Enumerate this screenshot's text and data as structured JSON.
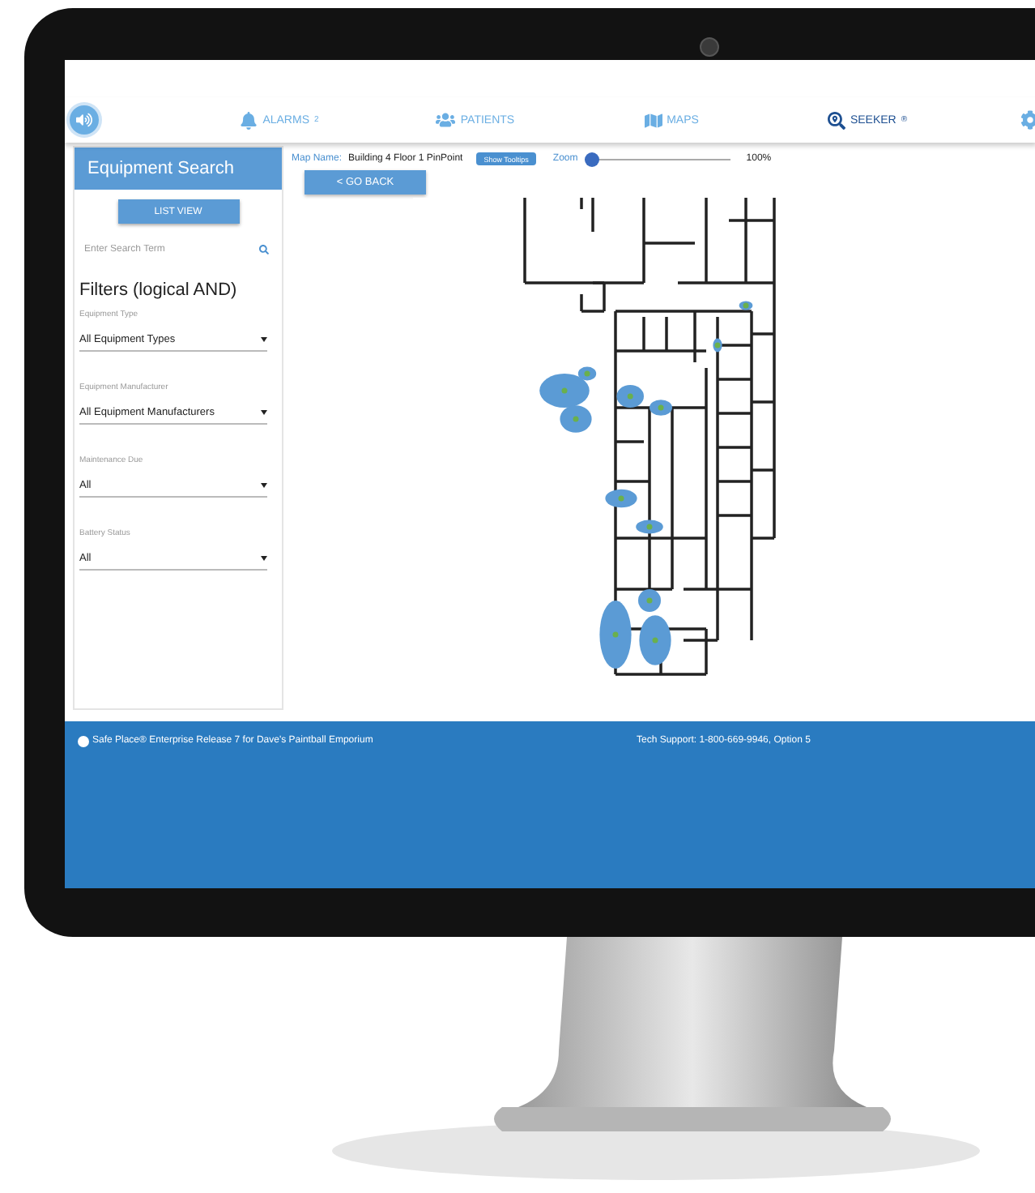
{
  "nav": {
    "items": [
      {
        "kind": "bell",
        "label": "ALARMS",
        "badge": "2",
        "selected": false
      },
      {
        "kind": "people",
        "label": "PATIENTS",
        "selected": false
      },
      {
        "kind": "map",
        "label": "MAPS",
        "selected": false
      },
      {
        "kind": "seeker",
        "label": "SEEKER",
        "badge": "®",
        "selected": true
      }
    ]
  },
  "sidebar": {
    "title": "Equipment Search",
    "list_button": "LIST VIEW",
    "search": {
      "placeholder": "Enter Search Term"
    },
    "filters_title": "Filters (logical AND)",
    "filters": [
      {
        "label": "Equipment Type",
        "value": "All Equipment Types"
      },
      {
        "label": "Equipment Manufacturer",
        "value": "All Equipment Manufacturers"
      },
      {
        "label": "Maintenance Due",
        "value": "All"
      },
      {
        "label": "Battery Status",
        "value": "All"
      }
    ]
  },
  "map": {
    "name_label": "Map Name:",
    "name": "Building 4 Floor 1 PinPoint",
    "tooltips_button": "Show Tooltips",
    "zoom_label": "Zoom",
    "zoom": {
      "level": 0,
      "reading": "100%"
    },
    "back_button": "< GO BACK"
  },
  "footer": {
    "product": "Safe Place® Enterprise Release 7 for Dave's Paintball Emporium",
    "support": "Tech Support: 1-800-669-9946, Option 5"
  }
}
